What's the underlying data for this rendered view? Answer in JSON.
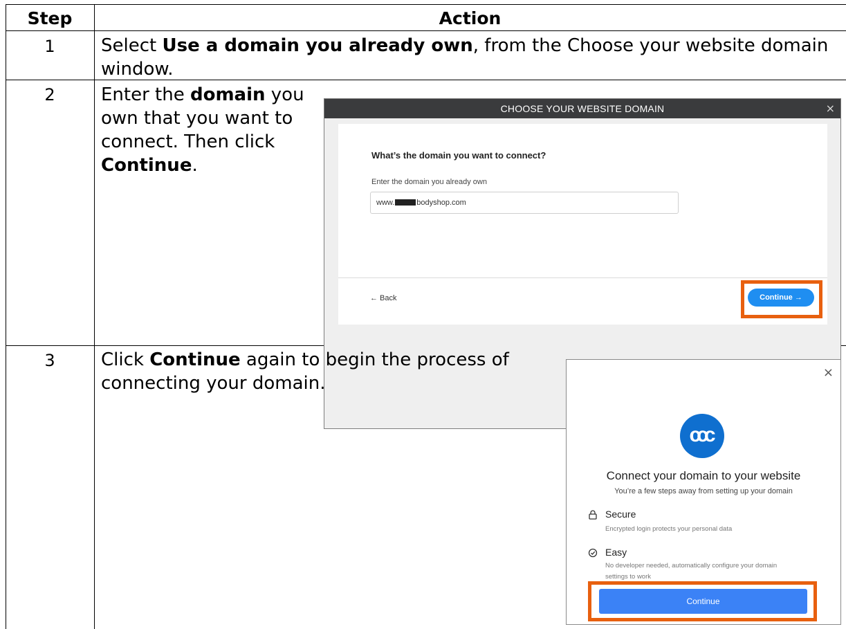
{
  "table": {
    "header_step": "Step",
    "header_action": "Action"
  },
  "rows": [
    {
      "step": "1",
      "text_pre": "Select ",
      "text_bold": "Use a domain you already own",
      "text_post_line1": ", from the Choose your website domain",
      "text_post_line2": "window."
    },
    {
      "step": "2",
      "line1_pre": "Enter the ",
      "line1_bold": "domain",
      "line1_post": " you",
      "line2": "own that you want to",
      "line3": "connect. Then click",
      "line4_bold": "Continue",
      "line4_post": "."
    },
    {
      "step": "3",
      "line1_pre": "Click ",
      "line1_bold": "Continue",
      "line1_post": " again to begin the process of",
      "line2": "connecting your domain."
    }
  ],
  "screenshot_domain": {
    "title": "CHOOSE YOUR WEBSITE DOMAIN",
    "close": "×",
    "question": "What’s the domain you want to connect?",
    "field_label": "Enter the domain you already own",
    "input_prefix": "www.",
    "input_suffix": "bodyshop.com",
    "back": "← Back",
    "continue": "Continue →",
    "highlight_color": "#e8600f"
  },
  "screenshot_connect": {
    "close": "×",
    "logo_text": "ccc",
    "title": "Connect your domain to your website",
    "subtitle": "You’re a few steps away from setting up your domain",
    "features": [
      {
        "icon": "lock-icon",
        "name": "Secure",
        "desc": "Encrypted login protects your personal data"
      },
      {
        "icon": "check-circle-icon",
        "name": "Easy",
        "desc": "No developer needed, automatically configure your domain settings to work"
      }
    ],
    "continue": "Continue",
    "accent": "#3b82f6"
  }
}
